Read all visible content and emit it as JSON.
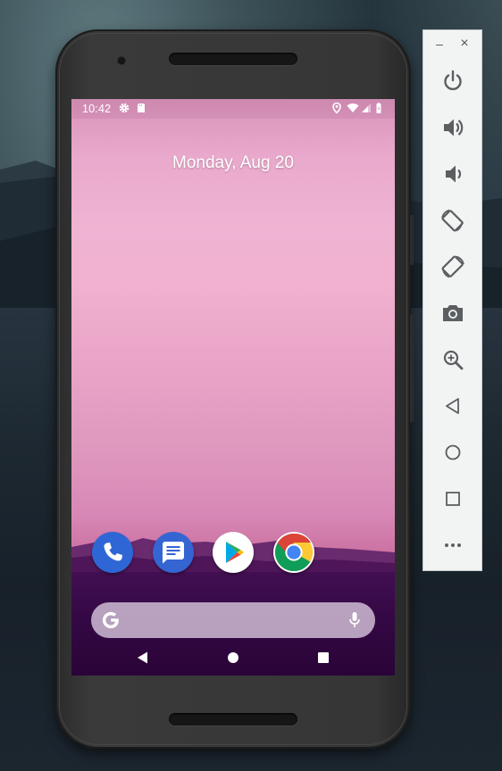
{
  "status_bar": {
    "time": "10:42",
    "icons": [
      "settings-icon",
      "sd-card-icon",
      "location-icon",
      "wifi-icon",
      "signal-icon",
      "battery-icon"
    ]
  },
  "home_screen": {
    "date": "Monday, Aug 20",
    "dock_apps": [
      "phone-icon",
      "messages-icon",
      "play-store-icon",
      "chrome-icon"
    ],
    "search_bar": {
      "logo": "google-g-icon",
      "mic": "mic-icon"
    },
    "nav_buttons": [
      "back-icon",
      "home-icon",
      "recents-icon"
    ]
  },
  "emulator_toolbar": {
    "window_controls": {
      "minimize": "–",
      "close": "×"
    },
    "buttons": [
      "power-icon",
      "volume-up-icon",
      "volume-down-icon",
      "rotate-left-icon",
      "rotate-right-icon",
      "camera-icon",
      "zoom-icon",
      "back-icon",
      "home-icon",
      "overview-icon",
      "more-icon"
    ]
  },
  "colors": {
    "wallpaper_top": "#f0b3d2",
    "wallpaper_bottom": "#3a0b4c",
    "toolbar_bg": "#f2f4f4",
    "toolbar_icon": "#5b5f62"
  }
}
